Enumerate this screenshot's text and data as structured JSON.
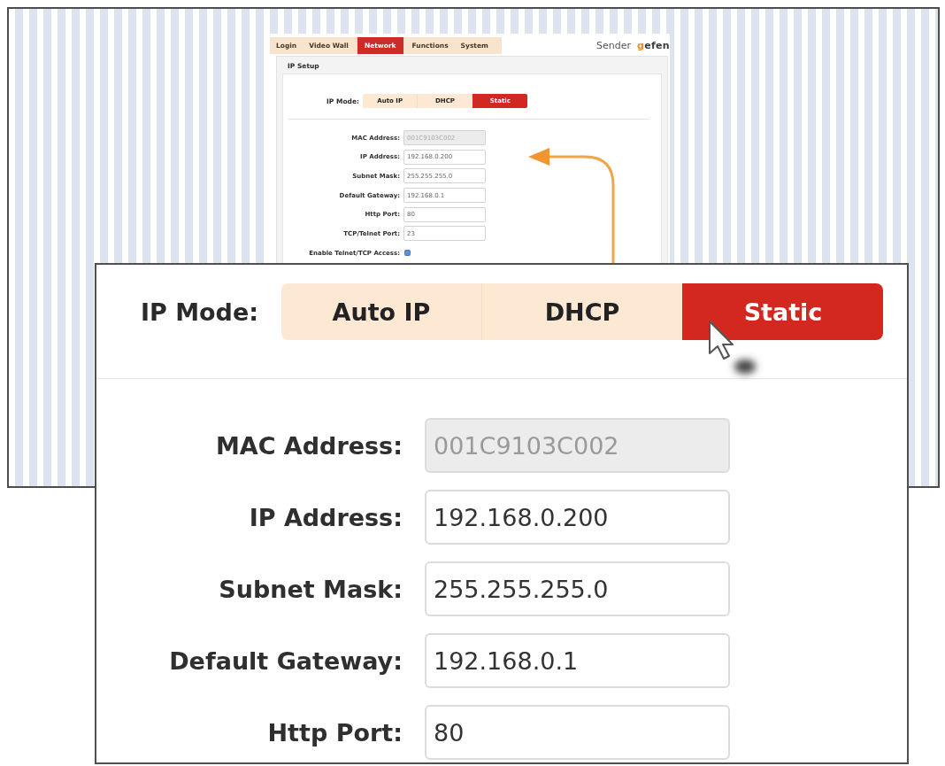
{
  "thumbnail": {
    "tabs": [
      {
        "label": "Login",
        "selected": false
      },
      {
        "label": "Video Wall",
        "selected": false
      },
      {
        "label": "Network",
        "selected": true
      },
      {
        "label": "Functions",
        "selected": false
      },
      {
        "label": "System",
        "selected": false
      }
    ],
    "device_label": "Sender",
    "logo": "gefen",
    "section_title": "IP Setup",
    "ip_mode": {
      "label": "IP Mode:",
      "options": [
        {
          "label": "Auto IP",
          "selected": false
        },
        {
          "label": "DHCP",
          "selected": false
        },
        {
          "label": "Static",
          "selected": true
        }
      ]
    },
    "fields": [
      {
        "kind": "text",
        "label": "MAC Address:",
        "value": "001C9103C002",
        "disabled": true
      },
      {
        "kind": "text",
        "label": "IP Address:",
        "value": "192.168.0.200",
        "disabled": false
      },
      {
        "kind": "text",
        "label": "Subnet Mask:",
        "value": "255.255.255.0",
        "disabled": false
      },
      {
        "kind": "text",
        "label": "Default Gateway:",
        "value": "192.168.0.1",
        "disabled": false
      },
      {
        "kind": "text",
        "label": "Http Port:",
        "value": "80",
        "disabled": false
      },
      {
        "kind": "text",
        "label": "TCP/Telnet Port:",
        "value": "23",
        "disabled": false
      },
      {
        "kind": "checkbox",
        "label": "Enable Telnet/TCP Access:",
        "checked": true
      }
    ]
  },
  "zoom_inset": {
    "ip_mode": {
      "label": "IP Mode:",
      "options": [
        {
          "label": "Auto IP",
          "selected": false
        },
        {
          "label": "DHCP",
          "selected": false
        },
        {
          "label": "Static",
          "selected": true
        }
      ]
    },
    "fields": [
      {
        "kind": "text",
        "label": "MAC Address:",
        "value": "001C9103C002",
        "disabled": true
      },
      {
        "kind": "text",
        "label": "IP Address:",
        "value": "192.168.0.200",
        "disabled": false
      },
      {
        "kind": "text",
        "label": "Subnet Mask:",
        "value": "255.255.255.0",
        "disabled": false
      },
      {
        "kind": "text",
        "label": "Default Gateway:",
        "value": "192.168.0.1",
        "disabled": false
      },
      {
        "kind": "text",
        "label": "Http Port:",
        "value": "80",
        "disabled": false
      }
    ]
  }
}
